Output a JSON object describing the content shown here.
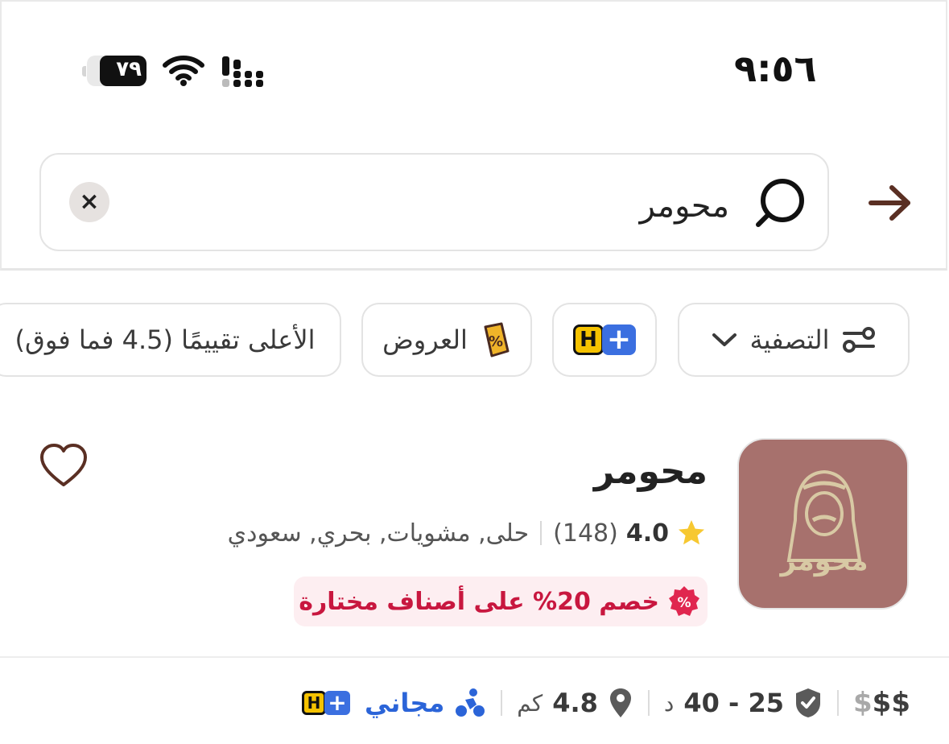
{
  "status_bar": {
    "time": "٩:٥٦",
    "battery_percent": "٧٩",
    "battery_level": 0.79
  },
  "search": {
    "value": "محومر",
    "clear_label": "×"
  },
  "filters": {
    "filter_label": "التصفية",
    "offers_label": "العروض",
    "top_rated_label": "الأعلى تقييمًا (4.5 فما فوق)",
    "hplus_badge": "H"
  },
  "restaurant": {
    "name": "محومر",
    "rating": "4.0",
    "reviews": "(148)",
    "cuisines": "حلى, مشويات, بحري, سعودي",
    "promo": "خصم 20% على أصناف مختارة",
    "logo_text": "محومر",
    "price_active": "$$",
    "price_inactive": "$",
    "delivery_time": "25 - 40",
    "delivery_time_unit": "د",
    "distance": "4.8",
    "distance_unit": "كم",
    "delivery_fee": "مجاني"
  },
  "colors": {
    "accent_brown": "#5a2f23",
    "promo_red": "#c8173f",
    "free_blue": "#2b64d8",
    "logo_bg": "#a7716d",
    "hplus_blue": "#3b6fe0",
    "hplus_yellow": "#f5c200"
  }
}
